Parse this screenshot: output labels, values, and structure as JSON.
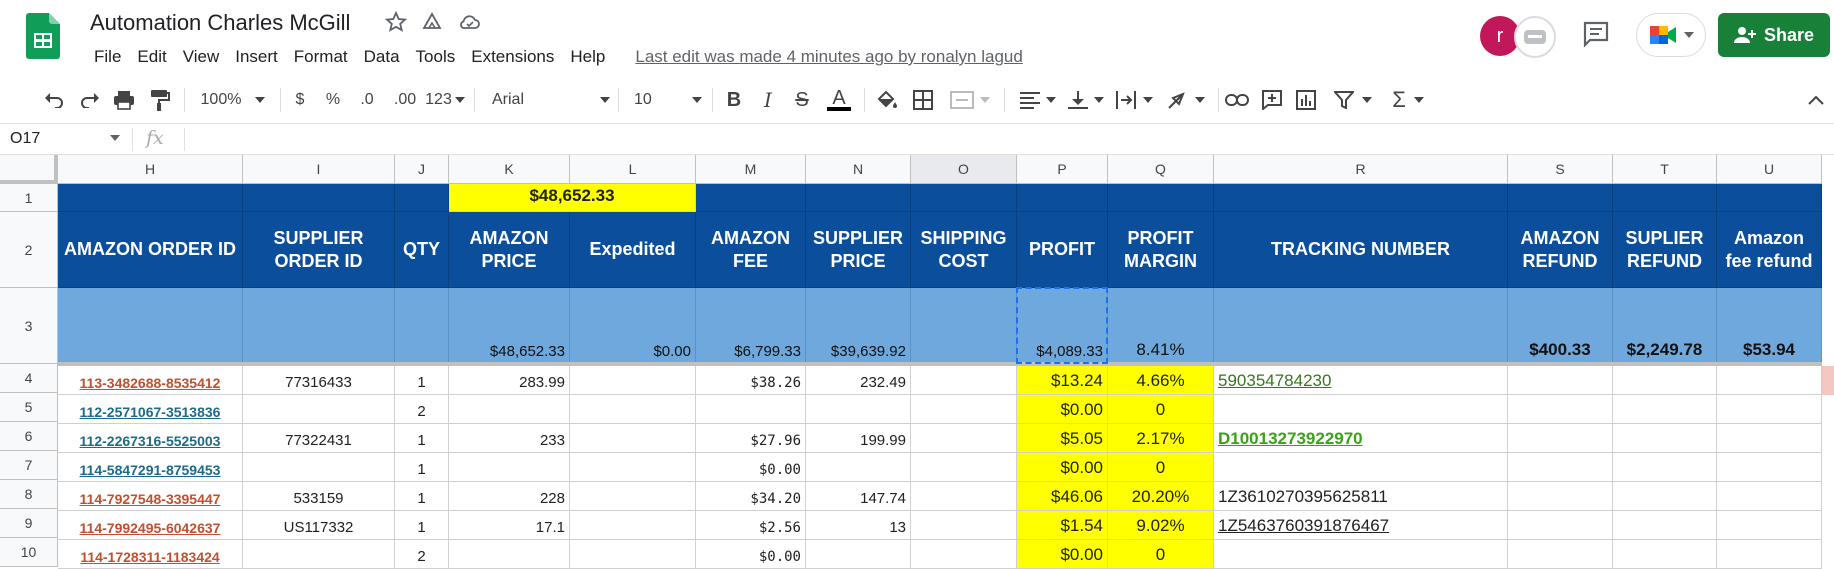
{
  "app": {
    "doc_title": "Automation Charles McGill",
    "last_edit": "Last edit was made 4 minutes ago by ronalyn lagud",
    "avatar_letter": "r",
    "share_label": "Share",
    "brand_color": "#188038"
  },
  "menu": [
    "File",
    "Edit",
    "View",
    "Insert",
    "Format",
    "Data",
    "Tools",
    "Extensions",
    "Help"
  ],
  "toolbar": {
    "zoom": "100%",
    "currency": "$",
    "percent": "%",
    "dec_less": ".0",
    "dec_more": ".00",
    "number_format": "123",
    "font": "Arial",
    "font_size": "10",
    "icons": [
      "undo-icon",
      "redo-icon",
      "print-icon",
      "paint-format-icon",
      "bold-icon",
      "italic-icon",
      "strikethrough-icon",
      "text-color-icon",
      "fill-color-icon",
      "borders-icon",
      "merge-icon",
      "align-icon",
      "valign-icon",
      "wrap-icon",
      "rotate-icon",
      "link-icon",
      "comment-icon",
      "chart-icon",
      "filter-icon",
      "functions-icon"
    ]
  },
  "formula_bar": {
    "cell_ref": "O17",
    "fx": "fx",
    "value": ""
  },
  "columns": [
    "H",
    "I",
    "J",
    "K",
    "L",
    "M",
    "N",
    "O",
    "P",
    "Q",
    "R",
    "S",
    "T",
    "U"
  ],
  "selected_column": "O",
  "row_numbers": [
    "1",
    "2",
    "3",
    "4",
    "5",
    "6",
    "7",
    "8",
    "9",
    "10"
  ],
  "row1": {
    "total": "$48,652.33"
  },
  "headers": {
    "H": "AMAZON ORDER ID",
    "I": "SUPPLIER ORDER ID",
    "J": "QTY",
    "K": "AMAZON PRICE",
    "L": "Expedited",
    "M": "AMAZON FEE",
    "N": "SUPPLIER PRICE",
    "O": "SHIPPING COST",
    "P": "PROFIT",
    "Q": "PROFIT MARGIN",
    "R": "TRACKING NUMBER",
    "S": "AMAZON REFUND",
    "T": "SUPLIER REFUND",
    "U": "Amazon fee refund"
  },
  "summary": {
    "K": "$48,652.33",
    "L": "$0.00",
    "M": "$6,799.33",
    "N": "$39,639.92",
    "P": "$4,089.33",
    "Q": "8.41%",
    "S": "$400.33",
    "T": "$2,249.78",
    "U": "$53.94"
  },
  "rows": [
    {
      "order_id": "113-3482688-8535412",
      "id_style": "red",
      "supplier_id": "77316433",
      "qty": "1",
      "amazon_price": "283.99",
      "expedited": "",
      "amazon_fee": "$38.26",
      "supplier_price": "232.49",
      "shipping": "",
      "profit": "$13.24",
      "margin": "4.66%",
      "tracking": "590354784230",
      "tracking_style": "green"
    },
    {
      "order_id": "112-2571067-3513836",
      "id_style": "teal",
      "supplier_id": "",
      "qty": "2",
      "amazon_price": "",
      "expedited": "",
      "amazon_fee": "",
      "supplier_price": "",
      "shipping": "",
      "profit": "$0.00",
      "margin": "0",
      "tracking": "",
      "tracking_style": "plain"
    },
    {
      "order_id": "112-2267316-5525003",
      "id_style": "teal",
      "supplier_id": "77322431",
      "qty": "1",
      "amazon_price": "233",
      "expedited": "",
      "amazon_fee": "$27.96",
      "supplier_price": "199.99",
      "shipping": "",
      "profit": "$5.05",
      "margin": "2.17%",
      "tracking": "D10013273922970",
      "tracking_style": "green-bold"
    },
    {
      "order_id": "114-5847291-8759453",
      "id_style": "teal",
      "supplier_id": "",
      "qty": "1",
      "amazon_price": "",
      "expedited": "",
      "amazon_fee": "$0.00",
      "supplier_price": "",
      "shipping": "",
      "profit": "$0.00",
      "margin": "0",
      "tracking": "",
      "tracking_style": "plain"
    },
    {
      "order_id": "114-7927548-3395447",
      "id_style": "red",
      "supplier_id": "533159",
      "qty": "1",
      "amazon_price": "228",
      "expedited": "",
      "amazon_fee": "$34.20",
      "supplier_price": "147.74",
      "shipping": "",
      "profit": "$46.06",
      "margin": "20.20%",
      "tracking": "1Z3610270395625811",
      "tracking_style": "plain"
    },
    {
      "order_id": "114-7992495-6042637",
      "id_style": "red",
      "supplier_id": "US117332",
      "qty": "1",
      "amazon_price": "17.1",
      "expedited": "",
      "amazon_fee": "$2.56",
      "supplier_price": "13",
      "shipping": "",
      "profit": "$1.54",
      "margin": "9.02%",
      "tracking": "1Z5463760391876467",
      "tracking_style": "underline"
    },
    {
      "order_id": "114-1728311-1183424",
      "id_style": "red",
      "supplier_id": "",
      "qty": "2",
      "amazon_price": "",
      "expedited": "",
      "amazon_fee": "$0.00",
      "supplier_price": "",
      "shipping": "",
      "profit": "$0.00",
      "margin": "0",
      "tracking": "",
      "tracking_style": "plain"
    }
  ],
  "colors": {
    "header_blue": "#0b4f9c",
    "summary_blue": "#6fa8dc",
    "highlight_yellow": "#ffff00",
    "order_red": "#c0502e",
    "order_teal": "#1d6b8a",
    "tracking_green": "#38761d"
  }
}
